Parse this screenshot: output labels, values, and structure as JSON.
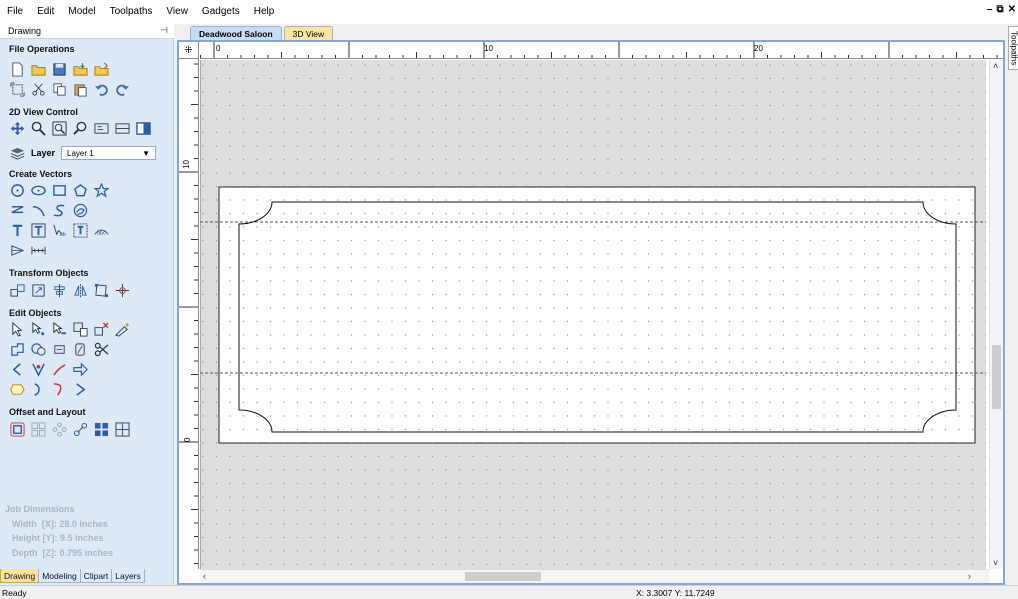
{
  "menu": [
    "File",
    "Edit",
    "Model",
    "Toolpaths",
    "View",
    "Gadgets",
    "Help"
  ],
  "window_controls": [
    "–",
    "⧉",
    "✕"
  ],
  "panel": {
    "title": "Drawing",
    "pin_icon": "pin-icon",
    "sections": {
      "file_operations": "File Operations",
      "view_control": "2D View Control",
      "create_vectors": "Create Vectors",
      "transform_objects": "Transform Objects",
      "edit_objects": "Edit Objects",
      "offset_layout": "Offset and Layout"
    },
    "layer": {
      "label": "Layer",
      "value": "Layer 1"
    },
    "job_dimensions": {
      "title": "Job Dimensions",
      "width": "Width  [X]: 28.0 inches",
      "height": "Height [Y]: 9.5 inches",
      "depth": "Depth  [Z]: 0.795 inches"
    },
    "bottom_tabs": [
      "Drawing",
      "Modeling",
      "Clipart",
      "Layers"
    ]
  },
  "document": {
    "tabs": [
      "Deadwood Saloon",
      "3D View"
    ],
    "ruler_labels": {
      "h": [
        "0",
        "10",
        "20"
      ],
      "v": [
        "10",
        "0"
      ]
    }
  },
  "right_tab": "Toolpaths",
  "status": {
    "ready": "Ready",
    "coords": "X: 3.3007 Y: 11.7249"
  },
  "colors": {
    "panel_bg": "#dde9f6",
    "frame_blue": "#86a7d3",
    "active_tab": "#fbe29b",
    "canvas_bg": "#dedede"
  }
}
